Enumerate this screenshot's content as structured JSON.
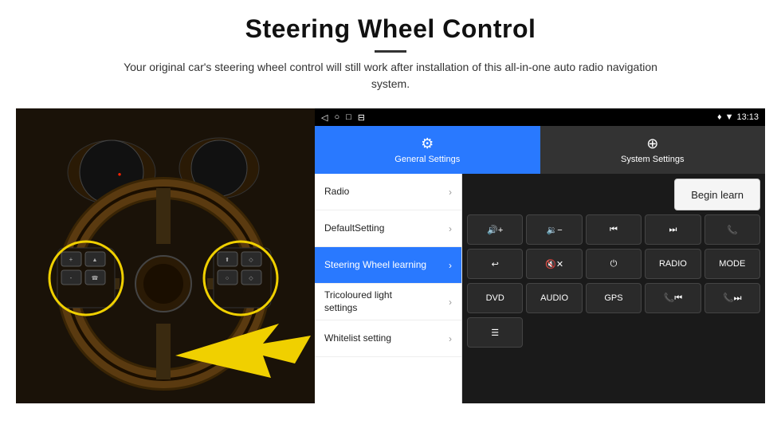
{
  "header": {
    "title": "Steering Wheel Control",
    "divider": true,
    "description": "Your original car's steering wheel control will still work after installation of this all-in-one auto radio navigation system."
  },
  "status_bar": {
    "time": "13:13",
    "icons_left": [
      "◁",
      "○",
      "□",
      "⊟"
    ],
    "icons_right": [
      "♦",
      "▼",
      "13:13"
    ]
  },
  "tabs": [
    {
      "id": "general",
      "label": "General Settings",
      "icon": "⚙",
      "active": true
    },
    {
      "id": "system",
      "label": "System Settings",
      "icon": "🔧",
      "active": false
    }
  ],
  "menu_items": [
    {
      "id": "radio",
      "label": "Radio",
      "active": false
    },
    {
      "id": "default",
      "label": "DefaultSetting",
      "active": false
    },
    {
      "id": "steering",
      "label": "Steering Wheel learning",
      "active": true
    },
    {
      "id": "tricoloured",
      "label": "Tricoloured light settings",
      "active": false
    },
    {
      "id": "whitelist",
      "label": "Whitelist setting",
      "active": false
    }
  ],
  "begin_learn_label": "Begin learn",
  "control_buttons": {
    "row1": [
      {
        "id": "vol_up",
        "label": "🔊+",
        "sym": true
      },
      {
        "id": "vol_down",
        "label": "🔉-",
        "sym": true
      },
      {
        "id": "prev_track",
        "label": "⏮",
        "sym": true
      },
      {
        "id": "next_track",
        "label": "⏭",
        "sym": true
      },
      {
        "id": "phone",
        "label": "📞",
        "sym": true
      }
    ],
    "row2": [
      {
        "id": "hang_up",
        "label": "📵",
        "sym": true
      },
      {
        "id": "mute",
        "label": "🔇x",
        "sym": true
      },
      {
        "id": "power",
        "label": "⏻",
        "sym": true
      },
      {
        "id": "radio_btn",
        "label": "RADIO",
        "sym": false
      },
      {
        "id": "mode",
        "label": "MODE",
        "sym": false
      }
    ],
    "row3": [
      {
        "id": "dvd",
        "label": "DVD",
        "sym": false
      },
      {
        "id": "audio",
        "label": "AUDIO",
        "sym": false
      },
      {
        "id": "gps",
        "label": "GPS",
        "sym": false
      },
      {
        "id": "phone_prev",
        "label": "📞⏮",
        "sym": true
      },
      {
        "id": "phone_next",
        "label": "📞⏭",
        "sym": true
      }
    ],
    "row4": [
      {
        "id": "list_icon",
        "label": "≡",
        "sym": true
      }
    ]
  }
}
